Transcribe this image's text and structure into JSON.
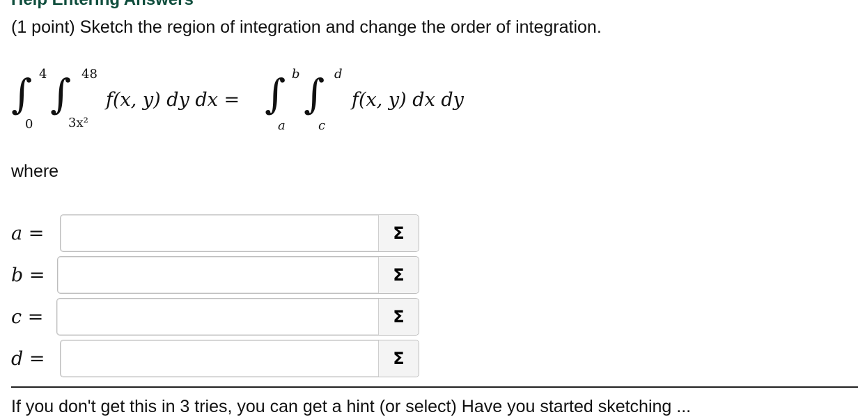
{
  "header": {
    "help_link": "Help Entering Answers"
  },
  "problem": {
    "prompt": "(1 point) Sketch the region of integration and change the order of integration.",
    "lhs": {
      "outer_upper": "4",
      "outer_lower": "0",
      "inner_upper": "48",
      "inner_lower": "3x²",
      "integrand": "f(x, y) dy dx ="
    },
    "rhs": {
      "outer_upper": "b",
      "outer_lower": "a",
      "inner_upper": "d",
      "inner_lower": "c",
      "integrand": "f(x, y) dx dy"
    },
    "where_label": "where"
  },
  "answers": [
    {
      "var": "a",
      "eq": "=",
      "value": ""
    },
    {
      "var": "b",
      "eq": "=",
      "value": ""
    },
    {
      "var": "c",
      "eq": "=",
      "value": ""
    },
    {
      "var": "d",
      "eq": "=",
      "value": ""
    }
  ],
  "equation_editor_icon": {
    "name": "sigma-icon",
    "glyph": "Σ"
  },
  "footer": {
    "text": "If you don't get this in 3 tries, you can get a hint (or select) Have you started sketching ..."
  }
}
